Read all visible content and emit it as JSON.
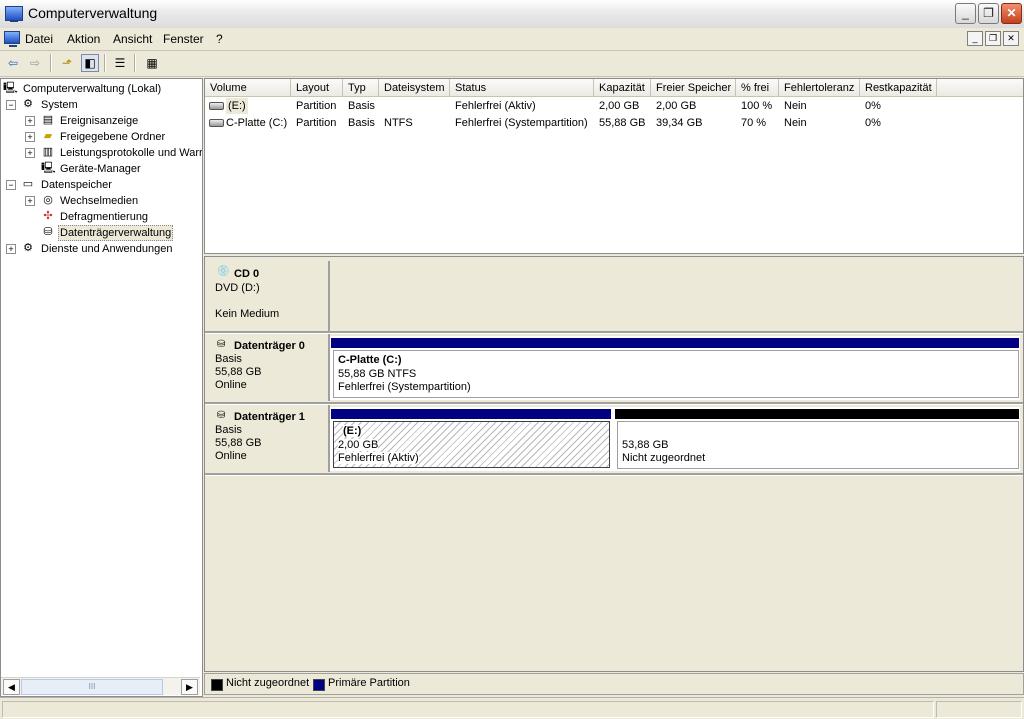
{
  "window": {
    "title": "Computerverwaltung"
  },
  "menu": {
    "items": [
      "Datei",
      "Aktion",
      "Ansicht",
      "Fenster",
      "?"
    ]
  },
  "toolbar": {
    "buttons": [
      "back-icon",
      "forward-icon",
      "up-folder-icon",
      "show-hide-tree-icon",
      "properties-icon",
      "help-icon"
    ]
  },
  "tree": {
    "root": "Computerverwaltung (Lokal)",
    "system": "System",
    "ereignisanzeige": "Ereignisanzeige",
    "freigegebene": "Freigegebene Ordner",
    "leistung": "Leistungsprotokolle und Warr",
    "geraete": "Geräte-Manager",
    "datenspeicher": "Datenspeicher",
    "wechselmedien": "Wechselmedien",
    "defrag": "Defragmentierung",
    "datentraeger": "Datenträgerverwaltung",
    "dienste": "Dienste und Anwendungen",
    "scroll_thumb": "III"
  },
  "volumes": {
    "columns": [
      "Volume",
      "Layout",
      "Typ",
      "Dateisystem",
      "Status",
      "Kapazität",
      "Freier Speicher",
      "% frei",
      "Fehlertoleranz",
      "Restkapazität"
    ],
    "rows": [
      {
        "volume": "(E:)",
        "layout": "Partition",
        "typ": "Basis",
        "dateisystem": "",
        "status": "Fehlerfrei (Aktiv)",
        "kapazitaet": "2,00 GB",
        "frei": "2,00 GB",
        "prozent": "100 %",
        "fehlertoleranz": "Nein",
        "rest": "0%"
      },
      {
        "volume": "C-Platte (C:)",
        "layout": "Partition",
        "typ": "Basis",
        "dateisystem": "NTFS",
        "status": "Fehlerfrei (Systempartition)",
        "kapazitaet": "55,88 GB",
        "frei": "39,34 GB",
        "prozent": "70 %",
        "fehlertoleranz": "Nein",
        "rest": "0%"
      }
    ]
  },
  "disks": {
    "cd0": {
      "name": "CD 0",
      "type": "DVD (D:)",
      "status": "Kein Medium"
    },
    "disk0": {
      "name": "Datenträger 0",
      "type": "Basis",
      "size": "55,88 GB",
      "state": "Online",
      "partition": {
        "title": "C-Platte  (C:)",
        "size": "55,88 GB NTFS",
        "status": "Fehlerfrei (Systempartition)"
      }
    },
    "disk1": {
      "name": "Datenträger 1",
      "type": "Basis",
      "size": "55,88 GB",
      "state": "Online",
      "partition": {
        "title": "(E:)",
        "size": "2,00 GB",
        "status": "Fehlerfrei (Aktiv)"
      },
      "unallocated": {
        "size": "53,88 GB",
        "status": "Nicht zugeordnet"
      }
    }
  },
  "legend": {
    "unallocated": "Nicht zugeordnet",
    "primary": "Primäre Partition"
  },
  "colors": {
    "primary": "#000080",
    "unallocated": "#000000",
    "window_bg": "#ece9d8"
  }
}
